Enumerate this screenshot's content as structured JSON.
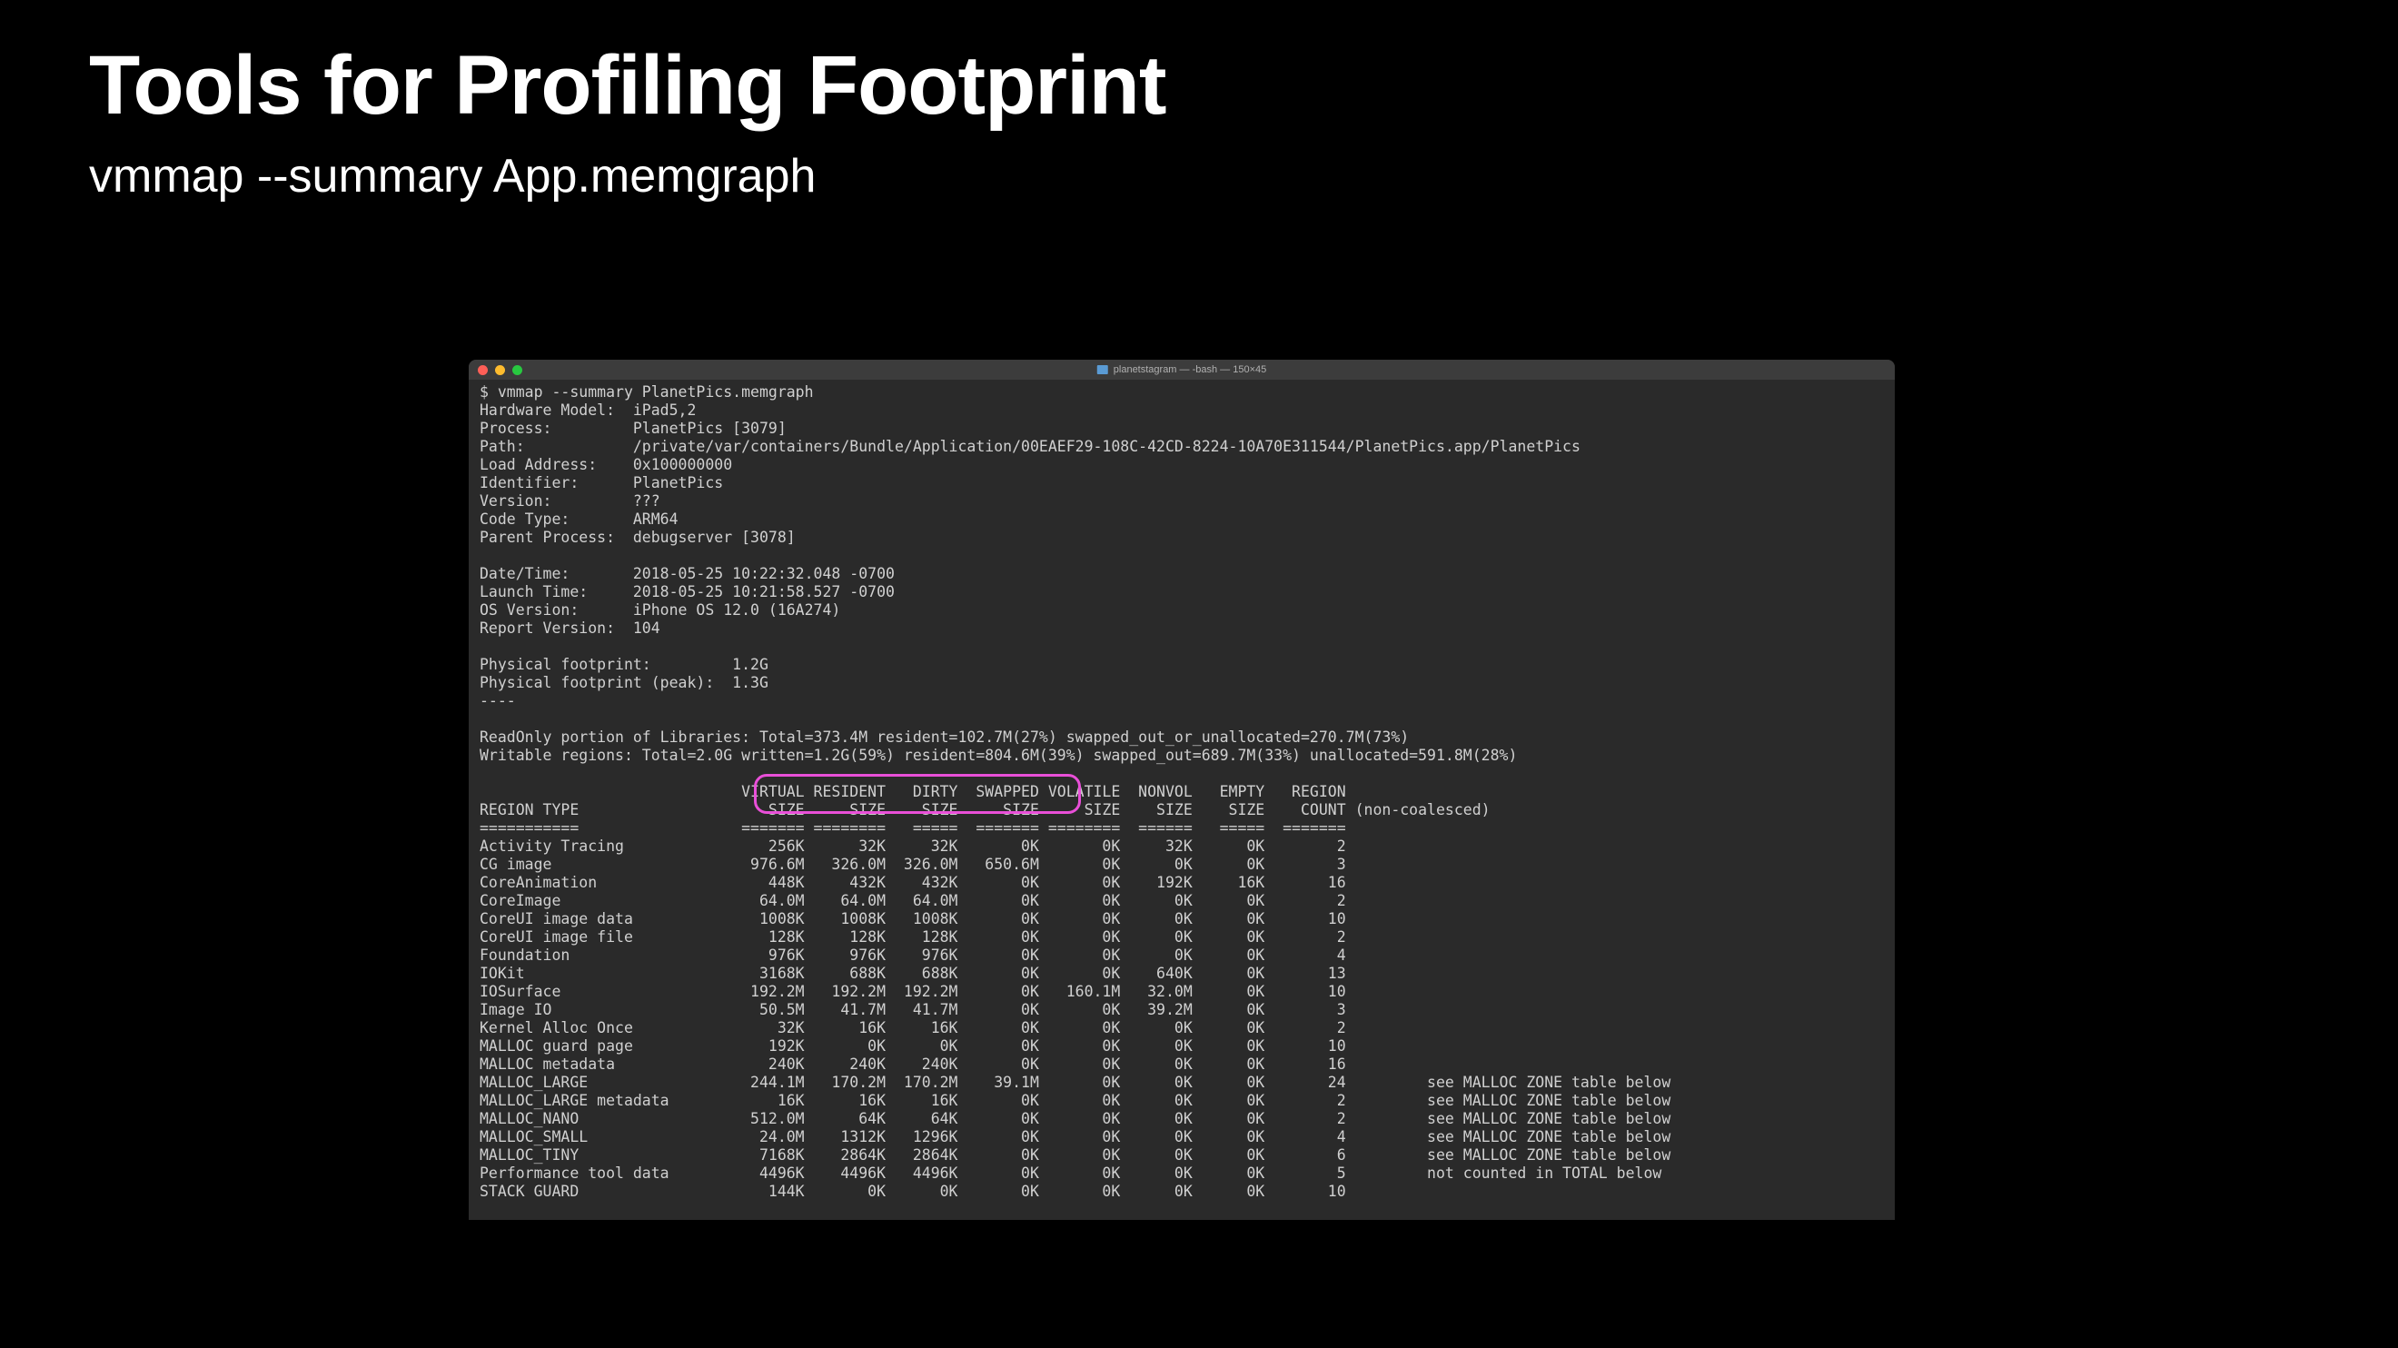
{
  "slide": {
    "title": "Tools for Profiling Footprint",
    "subtitle": "vmmap --summary App.memgraph"
  },
  "window": {
    "title": "planetstagram — -bash — 150×45"
  },
  "terminal": {
    "prompt": "$ vmmap --summary PlanetPics.memgraph",
    "meta": [
      {
        "label": "Hardware Model:",
        "value": "iPad5,2"
      },
      {
        "label": "Process:",
        "value": "PlanetPics [3079]"
      },
      {
        "label": "Path:",
        "value": "/private/var/containers/Bundle/Application/00EAEF29-108C-42CD-8224-10A70E311544/PlanetPics.app/PlanetPics"
      },
      {
        "label": "Load Address:",
        "value": "0x100000000"
      },
      {
        "label": "Identifier:",
        "value": "PlanetPics"
      },
      {
        "label": "Version:",
        "value": "???"
      },
      {
        "label": "Code Type:",
        "value": "ARM64"
      },
      {
        "label": "Parent Process:",
        "value": "debugserver [3078]"
      }
    ],
    "meta2": [
      {
        "label": "Date/Time:",
        "value": "2018-05-25 10:22:32.048 -0700"
      },
      {
        "label": "Launch Time:",
        "value": "2018-05-25 10:21:58.527 -0700"
      },
      {
        "label": "OS Version:",
        "value": "iPhone OS 12.0 (16A274)"
      },
      {
        "label": "Report Version:",
        "value": "104"
      }
    ],
    "footprint": [
      {
        "label": "Physical footprint:",
        "value": "1.2G"
      },
      {
        "label": "Physical footprint (peak):",
        "value": "1.3G"
      }
    ],
    "sep": "----",
    "readonly_line": "ReadOnly portion of Libraries: Total=373.4M resident=102.7M(27%) swapped_out_or_unallocated=270.7M(73%)",
    "writable_line": "Writable regions: Total=2.0G written=1.2G(59%) resident=804.6M(39%) swapped_out=689.7M(33%) unallocated=591.8M(28%)",
    "headers1": [
      "",
      "VIRTUAL",
      "RESIDENT",
      "DIRTY",
      "SWAPPED",
      "VOLATILE",
      "NONVOL",
      "EMPTY",
      "REGION",
      ""
    ],
    "headers2": [
      "REGION TYPE",
      "SIZE",
      "SIZE",
      "SIZE",
      "SIZE",
      "SIZE",
      "SIZE",
      "SIZE",
      "COUNT",
      "(non-coalesced)"
    ],
    "rows": [
      {
        "type": "Activity Tracing",
        "virt": "256K",
        "res": "32K",
        "dirty": "32K",
        "swap": "0K",
        "vol": "0K",
        "nonvol": "32K",
        "empty": "0K",
        "count": "2",
        "note": ""
      },
      {
        "type": "CG image",
        "virt": "976.6M",
        "res": "326.0M",
        "dirty": "326.0M",
        "swap": "650.6M",
        "vol": "0K",
        "nonvol": "0K",
        "empty": "0K",
        "count": "3",
        "note": ""
      },
      {
        "type": "CoreAnimation",
        "virt": "448K",
        "res": "432K",
        "dirty": "432K",
        "swap": "0K",
        "vol": "0K",
        "nonvol": "192K",
        "empty": "16K",
        "count": "16",
        "note": ""
      },
      {
        "type": "CoreImage",
        "virt": "64.0M",
        "res": "64.0M",
        "dirty": "64.0M",
        "swap": "0K",
        "vol": "0K",
        "nonvol": "0K",
        "empty": "0K",
        "count": "2",
        "note": ""
      },
      {
        "type": "CoreUI image data",
        "virt": "1008K",
        "res": "1008K",
        "dirty": "1008K",
        "swap": "0K",
        "vol": "0K",
        "nonvol": "0K",
        "empty": "0K",
        "count": "10",
        "note": ""
      },
      {
        "type": "CoreUI image file",
        "virt": "128K",
        "res": "128K",
        "dirty": "128K",
        "swap": "0K",
        "vol": "0K",
        "nonvol": "0K",
        "empty": "0K",
        "count": "2",
        "note": ""
      },
      {
        "type": "Foundation",
        "virt": "976K",
        "res": "976K",
        "dirty": "976K",
        "swap": "0K",
        "vol": "0K",
        "nonvol": "0K",
        "empty": "0K",
        "count": "4",
        "note": ""
      },
      {
        "type": "IOKit",
        "virt": "3168K",
        "res": "688K",
        "dirty": "688K",
        "swap": "0K",
        "vol": "0K",
        "nonvol": "640K",
        "empty": "0K",
        "count": "13",
        "note": ""
      },
      {
        "type": "IOSurface",
        "virt": "192.2M",
        "res": "192.2M",
        "dirty": "192.2M",
        "swap": "0K",
        "vol": "160.1M",
        "nonvol": "32.0M",
        "empty": "0K",
        "count": "10",
        "note": ""
      },
      {
        "type": "Image IO",
        "virt": "50.5M",
        "res": "41.7M",
        "dirty": "41.7M",
        "swap": "0K",
        "vol": "0K",
        "nonvol": "39.2M",
        "empty": "0K",
        "count": "3",
        "note": ""
      },
      {
        "type": "Kernel Alloc Once",
        "virt": "32K",
        "res": "16K",
        "dirty": "16K",
        "swap": "0K",
        "vol": "0K",
        "nonvol": "0K",
        "empty": "0K",
        "count": "2",
        "note": ""
      },
      {
        "type": "MALLOC guard page",
        "virt": "192K",
        "res": "0K",
        "dirty": "0K",
        "swap": "0K",
        "vol": "0K",
        "nonvol": "0K",
        "empty": "0K",
        "count": "10",
        "note": ""
      },
      {
        "type": "MALLOC metadata",
        "virt": "240K",
        "res": "240K",
        "dirty": "240K",
        "swap": "0K",
        "vol": "0K",
        "nonvol": "0K",
        "empty": "0K",
        "count": "16",
        "note": ""
      },
      {
        "type": "MALLOC_LARGE",
        "virt": "244.1M",
        "res": "170.2M",
        "dirty": "170.2M",
        "swap": "39.1M",
        "vol": "0K",
        "nonvol": "0K",
        "empty": "0K",
        "count": "24",
        "note": "see MALLOC ZONE table below"
      },
      {
        "type": "MALLOC_LARGE metadata",
        "virt": "16K",
        "res": "16K",
        "dirty": "16K",
        "swap": "0K",
        "vol": "0K",
        "nonvol": "0K",
        "empty": "0K",
        "count": "2",
        "note": "see MALLOC ZONE table below"
      },
      {
        "type": "MALLOC_NANO",
        "virt": "512.0M",
        "res": "64K",
        "dirty": "64K",
        "swap": "0K",
        "vol": "0K",
        "nonvol": "0K",
        "empty": "0K",
        "count": "2",
        "note": "see MALLOC ZONE table below"
      },
      {
        "type": "MALLOC_SMALL",
        "virt": "24.0M",
        "res": "1312K",
        "dirty": "1296K",
        "swap": "0K",
        "vol": "0K",
        "nonvol": "0K",
        "empty": "0K",
        "count": "4",
        "note": "see MALLOC ZONE table below"
      },
      {
        "type": "MALLOC_TINY",
        "virt": "7168K",
        "res": "2864K",
        "dirty": "2864K",
        "swap": "0K",
        "vol": "0K",
        "nonvol": "0K",
        "empty": "0K",
        "count": "6",
        "note": "see MALLOC ZONE table below"
      },
      {
        "type": "Performance tool data",
        "virt": "4496K",
        "res": "4496K",
        "dirty": "4496K",
        "swap": "0K",
        "vol": "0K",
        "nonvol": "0K",
        "empty": "0K",
        "count": "5",
        "note": "not counted in TOTAL below"
      },
      {
        "type": "STACK GUARD",
        "virt": "144K",
        "res": "0K",
        "dirty": "0K",
        "swap": "0K",
        "vol": "0K",
        "nonvol": "0K",
        "empty": "0K",
        "count": "10",
        "note": ""
      }
    ]
  }
}
